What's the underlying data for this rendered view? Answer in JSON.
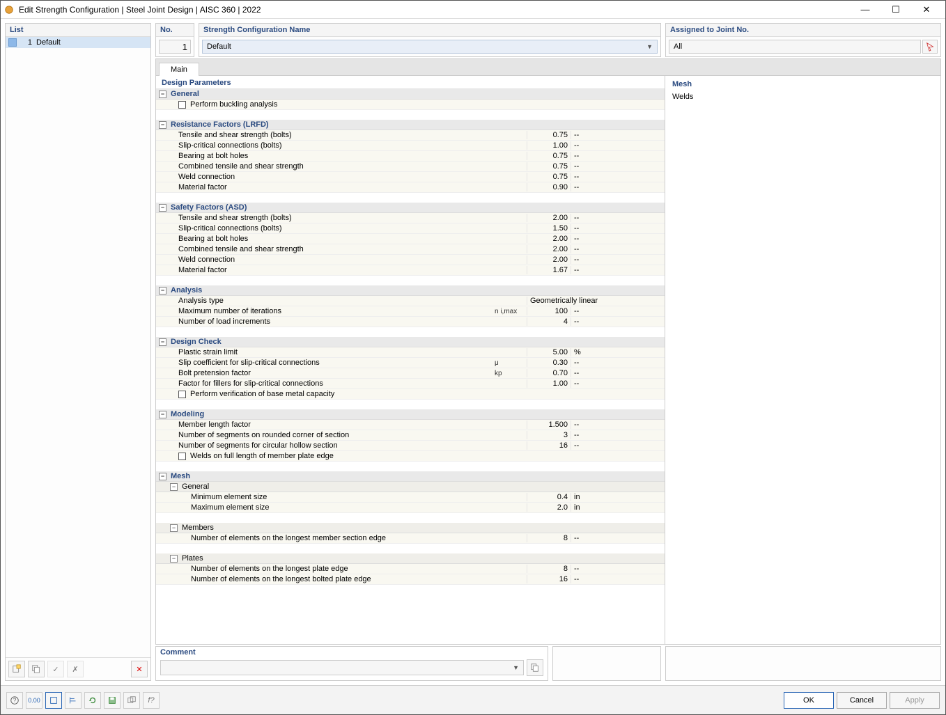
{
  "titlebar": {
    "title": "Edit Strength Configuration | Steel Joint Design | AISC 360 | 2022"
  },
  "sidebar": {
    "header": "List",
    "items": [
      {
        "num": "1",
        "label": "Default"
      }
    ]
  },
  "top": {
    "no_label": "No.",
    "no_value": "1",
    "name_label": "Strength Configuration Name",
    "name_value": "Default",
    "assigned_label": "Assigned to Joint No.",
    "assigned_value": "All"
  },
  "tabs": {
    "main": "Main"
  },
  "section": {
    "design_params": "Design Parameters"
  },
  "groups": {
    "general": "General",
    "resistance": "Resistance Factors (LRFD)",
    "safety": "Safety Factors (ASD)",
    "analysis": "Analysis",
    "designcheck": "Design Check",
    "modeling": "Modeling",
    "mesh": "Mesh",
    "mesh_general": "General",
    "mesh_members": "Members",
    "mesh_plates": "Plates"
  },
  "params": {
    "general": {
      "buckling": "Perform buckling analysis"
    },
    "resistance": [
      {
        "label": "Tensile and shear strength (bolts)",
        "val": "0.75",
        "unit": "--"
      },
      {
        "label": "Slip-critical connections (bolts)",
        "val": "1.00",
        "unit": "--"
      },
      {
        "label": "Bearing at bolt holes",
        "val": "0.75",
        "unit": "--"
      },
      {
        "label": "Combined tensile and shear strength",
        "val": "0.75",
        "unit": "--"
      },
      {
        "label": "Weld connection",
        "val": "0.75",
        "unit": "--"
      },
      {
        "label": "Material factor",
        "val": "0.90",
        "unit": "--"
      }
    ],
    "safety": [
      {
        "label": "Tensile and shear strength (bolts)",
        "val": "2.00",
        "unit": "--"
      },
      {
        "label": "Slip-critical connections (bolts)",
        "val": "1.50",
        "unit": "--"
      },
      {
        "label": "Bearing at bolt holes",
        "val": "2.00",
        "unit": "--"
      },
      {
        "label": "Combined tensile and shear strength",
        "val": "2.00",
        "unit": "--"
      },
      {
        "label": "Weld connection",
        "val": "2.00",
        "unit": "--"
      },
      {
        "label": "Material factor",
        "val": "1.67",
        "unit": "--"
      }
    ],
    "analysis": [
      {
        "label": "Analysis type",
        "sym": "",
        "val": "Geometrically linear",
        "unit": "",
        "wide": true
      },
      {
        "label": "Maximum number of iterations",
        "sym": "n i,max",
        "val": "100",
        "unit": "--"
      },
      {
        "label": "Number of load increments",
        "sym": "",
        "val": "4",
        "unit": "--"
      }
    ],
    "designcheck": [
      {
        "label": "Plastic strain limit",
        "sym": "",
        "val": "5.00",
        "unit": "%"
      },
      {
        "label": "Slip coefficient for slip-critical connections",
        "sym": "μ",
        "val": "0.30",
        "unit": "--"
      },
      {
        "label": "Bolt pretension factor",
        "sym": "kp",
        "val": "0.70",
        "unit": "--"
      },
      {
        "label": "Factor for fillers for slip-critical connections",
        "sym": "",
        "val": "1.00",
        "unit": "--"
      }
    ],
    "designcheck_chk": "Perform verification of base metal capacity",
    "modeling": [
      {
        "label": "Member length factor",
        "val": "1.500",
        "unit": "--"
      },
      {
        "label": "Number of segments on rounded corner of section",
        "val": "3",
        "unit": "--"
      },
      {
        "label": "Number of segments for circular hollow section",
        "val": "16",
        "unit": "--"
      }
    ],
    "modeling_chk": "Welds on full length of member plate edge",
    "mesh_general": [
      {
        "label": "Minimum element size",
        "val": "0.4",
        "unit": "in"
      },
      {
        "label": "Maximum element size",
        "val": "2.0",
        "unit": "in"
      }
    ],
    "mesh_members": [
      {
        "label": "Number of elements on the longest member section edge",
        "val": "8",
        "unit": "--"
      }
    ],
    "mesh_plates": [
      {
        "label": "Number of elements on the longest plate edge",
        "val": "8",
        "unit": "--"
      },
      {
        "label": "Number of elements on the longest bolted plate edge",
        "val": "16",
        "unit": "--"
      }
    ]
  },
  "info": {
    "heading": "Mesh",
    "line1": "Welds"
  },
  "comment": {
    "label": "Comment",
    "value": ""
  },
  "buttons": {
    "ok": "OK",
    "cancel": "Cancel",
    "apply": "Apply"
  }
}
